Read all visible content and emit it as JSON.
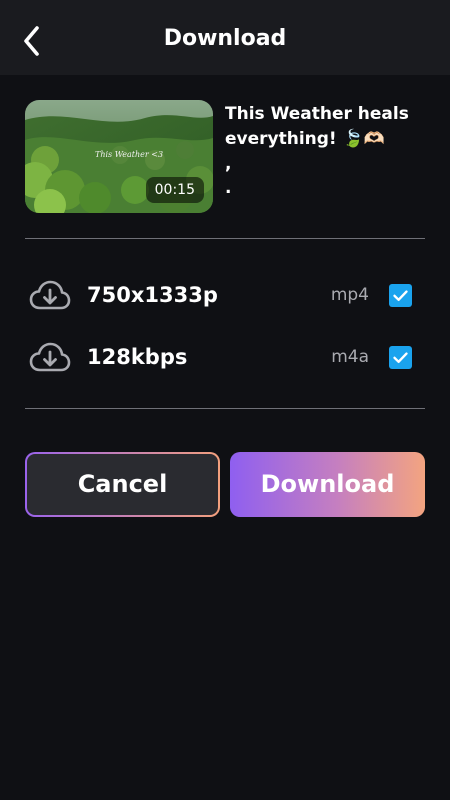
{
  "header": {
    "title": "Download",
    "back_icon": "chevron-left-icon"
  },
  "video": {
    "title": "This Weather heals everything! 🍃🫶🏻",
    "extra_lines": [
      ",",
      "."
    ],
    "duration": "00:15",
    "thumbnail_caption": "This Weather <3"
  },
  "options": [
    {
      "icon": "cloud-download-icon",
      "label": "750x1333p",
      "format": "mp4",
      "checked": true
    },
    {
      "icon": "cloud-download-icon",
      "label": "128kbps",
      "format": "m4a",
      "checked": true
    }
  ],
  "actions": {
    "cancel_label": "Cancel",
    "download_label": "Download"
  },
  "colors": {
    "background": "#0f1014",
    "header_bg": "#1a1b1f",
    "checkbox": "#1aa3ee",
    "gradient_start": "#8f5ff0",
    "gradient_end": "#f3a480",
    "muted_text": "#a9aab0"
  }
}
